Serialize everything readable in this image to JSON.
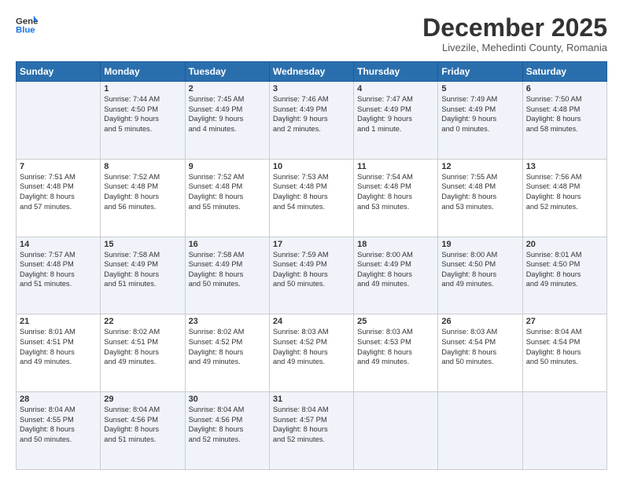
{
  "logo": {
    "line1": "General",
    "line2": "Blue"
  },
  "title": "December 2025",
  "location": "Livezile, Mehedinti County, Romania",
  "days_header": [
    "Sunday",
    "Monday",
    "Tuesday",
    "Wednesday",
    "Thursday",
    "Friday",
    "Saturday"
  ],
  "weeks": [
    [
      {
        "num": "",
        "text": ""
      },
      {
        "num": "1",
        "text": "Sunrise: 7:44 AM\nSunset: 4:50 PM\nDaylight: 9 hours\nand 5 minutes."
      },
      {
        "num": "2",
        "text": "Sunrise: 7:45 AM\nSunset: 4:49 PM\nDaylight: 9 hours\nand 4 minutes."
      },
      {
        "num": "3",
        "text": "Sunrise: 7:46 AM\nSunset: 4:49 PM\nDaylight: 9 hours\nand 2 minutes."
      },
      {
        "num": "4",
        "text": "Sunrise: 7:47 AM\nSunset: 4:49 PM\nDaylight: 9 hours\nand 1 minute."
      },
      {
        "num": "5",
        "text": "Sunrise: 7:49 AM\nSunset: 4:49 PM\nDaylight: 9 hours\nand 0 minutes."
      },
      {
        "num": "6",
        "text": "Sunrise: 7:50 AM\nSunset: 4:48 PM\nDaylight: 8 hours\nand 58 minutes."
      }
    ],
    [
      {
        "num": "7",
        "text": "Sunrise: 7:51 AM\nSunset: 4:48 PM\nDaylight: 8 hours\nand 57 minutes."
      },
      {
        "num": "8",
        "text": "Sunrise: 7:52 AM\nSunset: 4:48 PM\nDaylight: 8 hours\nand 56 minutes."
      },
      {
        "num": "9",
        "text": "Sunrise: 7:52 AM\nSunset: 4:48 PM\nDaylight: 8 hours\nand 55 minutes."
      },
      {
        "num": "10",
        "text": "Sunrise: 7:53 AM\nSunset: 4:48 PM\nDaylight: 8 hours\nand 54 minutes."
      },
      {
        "num": "11",
        "text": "Sunrise: 7:54 AM\nSunset: 4:48 PM\nDaylight: 8 hours\nand 53 minutes."
      },
      {
        "num": "12",
        "text": "Sunrise: 7:55 AM\nSunset: 4:48 PM\nDaylight: 8 hours\nand 53 minutes."
      },
      {
        "num": "13",
        "text": "Sunrise: 7:56 AM\nSunset: 4:48 PM\nDaylight: 8 hours\nand 52 minutes."
      }
    ],
    [
      {
        "num": "14",
        "text": "Sunrise: 7:57 AM\nSunset: 4:48 PM\nDaylight: 8 hours\nand 51 minutes."
      },
      {
        "num": "15",
        "text": "Sunrise: 7:58 AM\nSunset: 4:49 PM\nDaylight: 8 hours\nand 51 minutes."
      },
      {
        "num": "16",
        "text": "Sunrise: 7:58 AM\nSunset: 4:49 PM\nDaylight: 8 hours\nand 50 minutes."
      },
      {
        "num": "17",
        "text": "Sunrise: 7:59 AM\nSunset: 4:49 PM\nDaylight: 8 hours\nand 50 minutes."
      },
      {
        "num": "18",
        "text": "Sunrise: 8:00 AM\nSunset: 4:49 PM\nDaylight: 8 hours\nand 49 minutes."
      },
      {
        "num": "19",
        "text": "Sunrise: 8:00 AM\nSunset: 4:50 PM\nDaylight: 8 hours\nand 49 minutes."
      },
      {
        "num": "20",
        "text": "Sunrise: 8:01 AM\nSunset: 4:50 PM\nDaylight: 8 hours\nand 49 minutes."
      }
    ],
    [
      {
        "num": "21",
        "text": "Sunrise: 8:01 AM\nSunset: 4:51 PM\nDaylight: 8 hours\nand 49 minutes."
      },
      {
        "num": "22",
        "text": "Sunrise: 8:02 AM\nSunset: 4:51 PM\nDaylight: 8 hours\nand 49 minutes."
      },
      {
        "num": "23",
        "text": "Sunrise: 8:02 AM\nSunset: 4:52 PM\nDaylight: 8 hours\nand 49 minutes."
      },
      {
        "num": "24",
        "text": "Sunrise: 8:03 AM\nSunset: 4:52 PM\nDaylight: 8 hours\nand 49 minutes."
      },
      {
        "num": "25",
        "text": "Sunrise: 8:03 AM\nSunset: 4:53 PM\nDaylight: 8 hours\nand 49 minutes."
      },
      {
        "num": "26",
        "text": "Sunrise: 8:03 AM\nSunset: 4:54 PM\nDaylight: 8 hours\nand 50 minutes."
      },
      {
        "num": "27",
        "text": "Sunrise: 8:04 AM\nSunset: 4:54 PM\nDaylight: 8 hours\nand 50 minutes."
      }
    ],
    [
      {
        "num": "28",
        "text": "Sunrise: 8:04 AM\nSunset: 4:55 PM\nDaylight: 8 hours\nand 50 minutes."
      },
      {
        "num": "29",
        "text": "Sunrise: 8:04 AM\nSunset: 4:56 PM\nDaylight: 8 hours\nand 51 minutes."
      },
      {
        "num": "30",
        "text": "Sunrise: 8:04 AM\nSunset: 4:56 PM\nDaylight: 8 hours\nand 52 minutes."
      },
      {
        "num": "31",
        "text": "Sunrise: 8:04 AM\nSunset: 4:57 PM\nDaylight: 8 hours\nand 52 minutes."
      },
      {
        "num": "",
        "text": ""
      },
      {
        "num": "",
        "text": ""
      },
      {
        "num": "",
        "text": ""
      }
    ]
  ]
}
